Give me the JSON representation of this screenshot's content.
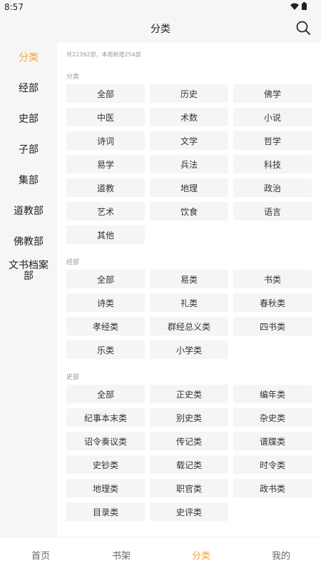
{
  "status_bar": {
    "time": "8:57"
  },
  "header": {
    "title": "分类"
  },
  "colors": {
    "accent": "#f2a23a",
    "chip_bg": "#f5f5f5",
    "page_bg": "#f6f6f6"
  },
  "icons": {
    "search": "search-icon",
    "wifi": "wifi-icon",
    "battery": "battery-icon"
  },
  "sidebar": {
    "items": [
      {
        "label": "分类",
        "active": true
      },
      {
        "label": "经部",
        "active": false
      },
      {
        "label": "史部",
        "active": false
      },
      {
        "label": "子部",
        "active": false
      },
      {
        "label": "集部",
        "active": false
      },
      {
        "label": "道教部",
        "active": false
      },
      {
        "label": "佛教部",
        "active": false
      },
      {
        "label": "文书档案部",
        "active": false
      }
    ]
  },
  "summary": "共22392部，本周新增254部",
  "sections": [
    {
      "title": "分类",
      "chips": [
        "全部",
        "历史",
        "佛学",
        "中医",
        "术数",
        "小说",
        "诗词",
        "文学",
        "哲学",
        "易学",
        "兵法",
        "科技",
        "道教",
        "地理",
        "政治",
        "艺术",
        "饮食",
        "语言",
        "其他"
      ]
    },
    {
      "title": "经部",
      "chips": [
        "全部",
        "易类",
        "书类",
        "诗类",
        "礼类",
        "春秋类",
        "孝经类",
        "群经总义类",
        "四书类",
        "乐类",
        "小学类"
      ]
    },
    {
      "title": "史部",
      "chips": [
        "全部",
        "正史类",
        "编年类",
        "纪事本末类",
        "别史类",
        "杂史类",
        "诏令奏议类",
        "传记类",
        "谱牒类",
        "史钞类",
        "载记类",
        "时令类",
        "地理类",
        "职官类",
        "政书类",
        "目录类",
        "史评类"
      ]
    }
  ],
  "bottom_nav": {
    "tabs": [
      {
        "label": "首页",
        "active": false
      },
      {
        "label": "书架",
        "active": false
      },
      {
        "label": "分类",
        "active": true
      },
      {
        "label": "我的",
        "active": false
      }
    ]
  }
}
